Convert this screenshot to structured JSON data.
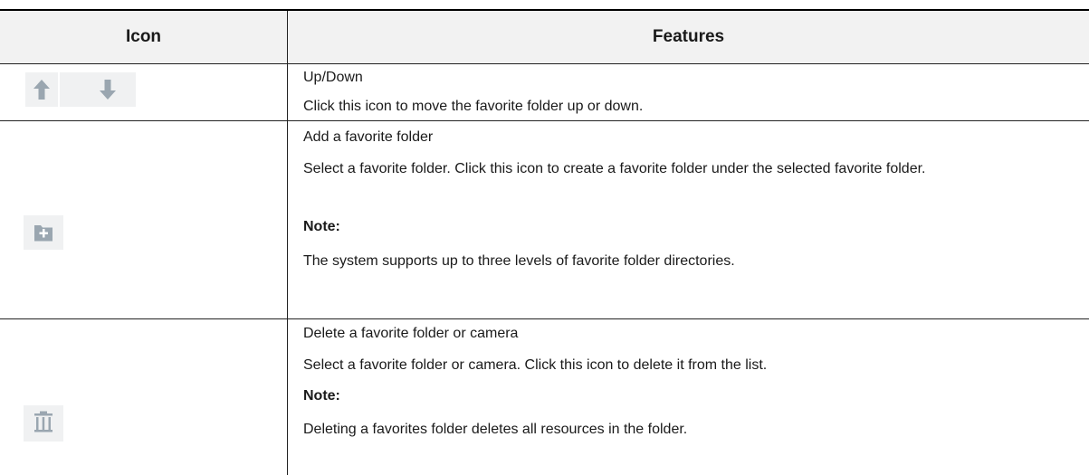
{
  "table": {
    "headers": {
      "icon": "Icon",
      "features": "Features"
    },
    "rows": [
      {
        "icons": [
          "arrow-up-icon",
          "arrow-down-icon"
        ],
        "title": "Up/Down",
        "description": "Click this icon to move the favorite folder up or down."
      },
      {
        "icons": [
          "add-folder-icon"
        ],
        "title": "Add a favorite folder",
        "description": "Select a favorite folder. Click this icon to create a favorite folder under the selected favorite folder.",
        "note_label": "Note:",
        "note": "The system supports up to three levels of favorite folder directories."
      },
      {
        "icons": [
          "trash-icon"
        ],
        "title": "Delete a favorite folder or camera",
        "description": "Select a favorite folder or camera. Click this icon to delete it from the list.",
        "note_label": "Note:",
        "note": "Deleting a favorites folder deletes all resources in the folder."
      }
    ]
  },
  "colors": {
    "icon_fill": "#9aa6b0",
    "icon_bg": "#f0f1f2",
    "header_bg": "#f2f2f2"
  }
}
